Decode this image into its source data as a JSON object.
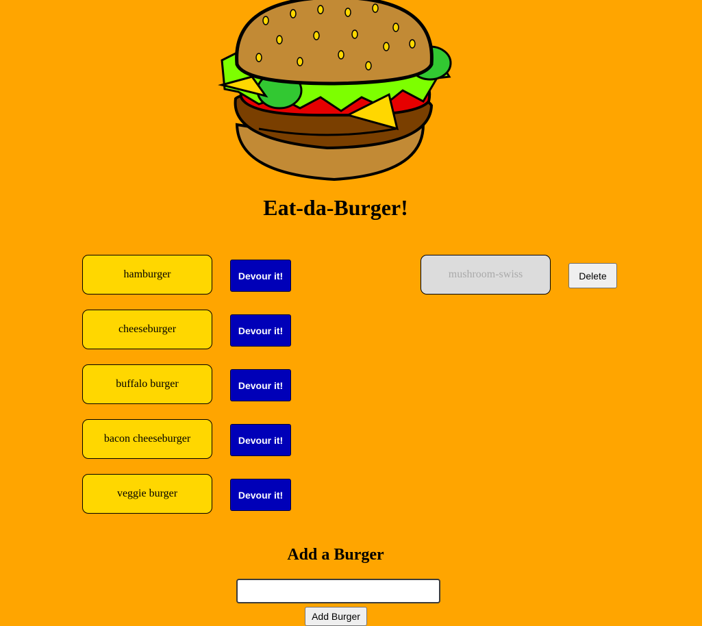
{
  "header": {
    "title": "Eat-da-Burger!"
  },
  "burgers_to_eat": [
    {
      "name": "hamburger",
      "action_label": "Devour it!"
    },
    {
      "name": "cheeseburger",
      "action_label": "Devour it!"
    },
    {
      "name": "buffalo burger",
      "action_label": "Devour it!"
    },
    {
      "name": "bacon cheeseburger",
      "action_label": "Devour it!"
    },
    {
      "name": "veggie burger",
      "action_label": "Devour it!"
    }
  ],
  "devoured_burgers": [
    {
      "name": "mushroom-swiss",
      "action_label": "Delete"
    }
  ],
  "add_form": {
    "heading": "Add a Burger",
    "input_value": "",
    "submit_label": "Add Burger"
  },
  "colors": {
    "page_background": "#ffa500",
    "burger_card": "#ffd700",
    "devoured_card": "#dcdcdc",
    "devour_button": "#0000b8"
  }
}
